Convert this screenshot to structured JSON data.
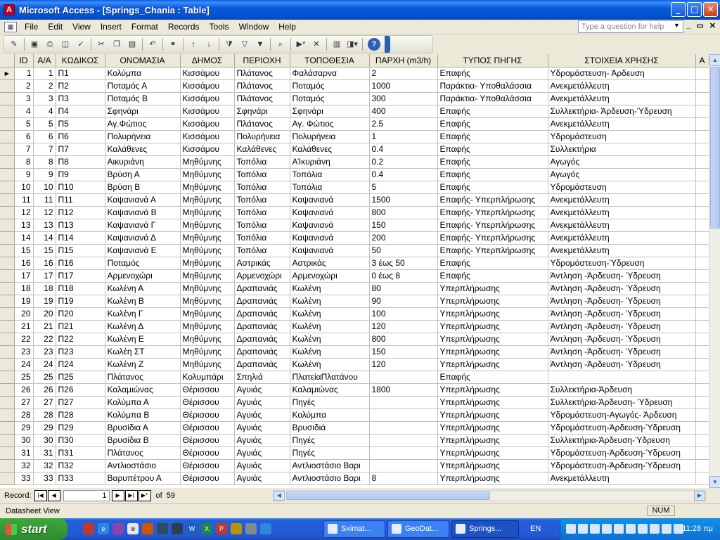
{
  "window": {
    "app_icon": "A",
    "title": "Microsoft Access - [Springs_Chania : Table]",
    "minimize": "_",
    "maximize": "□",
    "close": "✕"
  },
  "menu": {
    "items": [
      "File",
      "Edit",
      "View",
      "Insert",
      "Format",
      "Records",
      "Tools",
      "Window",
      "Help"
    ],
    "help_placeholder": "Type a question for help",
    "mdi": [
      "_",
      "▭",
      "✕"
    ]
  },
  "toolbar": {
    "icons": [
      "design-view-icon",
      "save-icon",
      "print-icon",
      "print-preview-icon",
      "spelling-icon",
      "cut-icon",
      "copy-icon",
      "paste-icon",
      "undo-icon",
      "hyperlink-icon",
      "sort-ascending-icon",
      "sort-descending-icon",
      "filter-by-selection-icon",
      "filter-by-form-icon",
      "apply-filter-icon",
      "find-icon",
      "new-record-icon",
      "delete-record-icon",
      "database-window-icon",
      "new-object-icon",
      "help-icon"
    ]
  },
  "table": {
    "columns": [
      "ID",
      "Α/Α",
      "ΚΩΔΙΚΟΣ",
      "ΟΝΟΜΑΣΙΑ",
      "ΔΗΜΟΣ",
      "ΠΕΡΙΟΧΗ",
      "ΤΟΠΟΘΕΣΙΑ",
      "ΠΑΡΧΗ (m3/h)",
      "ΤΥΠΟΣ ΠΗΓΗΣ",
      "ΣΤΟΙΧΕΙΑ ΧΡΗΣΗΣ",
      "Α"
    ],
    "rows": [
      [
        "1",
        "1",
        "Π1",
        "Κολύμπα",
        "Κισσάμου",
        "Πλάτανος",
        "Φαλάσαρνα",
        "2",
        "Επαφής",
        "Υδρομάστευση- Άρδευση"
      ],
      [
        "2",
        "2",
        "Π2",
        "Ποταμός Α",
        "Κισσάμου",
        "Πλάτανος",
        "Ποταμός",
        "1000",
        "Παράκτια- Υποθαλάσσια",
        "Ανεκμετάλλευτη"
      ],
      [
        "3",
        "3",
        "Π3",
        "Ποταμός Β",
        "Κισσάμου",
        "Πλάτανος",
        "Ποταμός",
        "300",
        "Παράκτια- Υποθαλάσσια",
        "Ανεκμετάλλευτη"
      ],
      [
        "4",
        "4",
        "Π4",
        "Σφηνάρι",
        "Κισσάμου",
        "Σφηνάρι",
        "Σφηνάρι",
        "400",
        "Επαφής",
        "Συλλεκτήρια- Άρδευση-Ύδρευση"
      ],
      [
        "5",
        "5",
        "Π5",
        "Αγ.Φώτιος",
        "Κισσάμου",
        "Πλάτανος",
        "Αγ. Φώτιος",
        "2.5",
        "Επαφής",
        "Ανεκμετάλλευτη"
      ],
      [
        "6",
        "6",
        "Π6",
        "Πολυρήνεια",
        "Κισσάμου",
        "Πολυρήνεια",
        "Πολυρήνεια",
        "1",
        "Επαφής",
        "Υδρομάστευση"
      ],
      [
        "7",
        "7",
        "Π7",
        "Καλάθενες",
        "Κισσάμου",
        "Καλάθενες",
        "Καλάθενες",
        "0.4",
        "Επαφής",
        "Συλλεκτήρια"
      ],
      [
        "8",
        "8",
        "Π8",
        "Αικυριάνη",
        "Μηθύμνης",
        "Τοπόλια",
        "ΑΊκυριάνη",
        "0.2",
        "Επαφής",
        "Αγωγός"
      ],
      [
        "9",
        "9",
        "Π9",
        "Βρύση Α",
        "Μηθύμνης",
        "Τοπόλια",
        "Τοπόλια",
        "0.4",
        "Επαφής",
        "Αγωγός"
      ],
      [
        "10",
        "10",
        "Π10",
        "Βρύση Β",
        "Μηθύμνης",
        "Τοπόλια",
        "Τοπόλια",
        "5",
        "Επαφής",
        "Υδρομάστευση"
      ],
      [
        "11",
        "11",
        "Π11",
        "Καψανιανά Α",
        "Μηθύμνης",
        "Τοπόλια",
        "Καψανιανά",
        "1500",
        "Επαφής- Υπερπλήρωσης",
        "Ανεκμετάλλευτη"
      ],
      [
        "12",
        "12",
        "Π12",
        "Καψανιανά Β",
        "Μηθύμνης",
        "Τοπόλια",
        "Καψανιανά",
        "800",
        "Επαφής- Υπερπλήρωσης",
        "Ανεκμετάλλευτη"
      ],
      [
        "13",
        "13",
        "Π13",
        "Καψανιανά Γ",
        "Μηθύμνης",
        "Τοπόλια",
        "Καψανιανά",
        "150",
        "Επαφής- Υπερπλήρωσης",
        "Ανεκμετάλλευτη"
      ],
      [
        "14",
        "14",
        "Π14",
        "Καψανιανά Δ",
        "Μηθύμνης",
        "Τοπόλια",
        "Καψανιανά",
        "200",
        "Επαφής- Υπερπλήρωσης",
        "Ανεκμετάλλευτη"
      ],
      [
        "15",
        "15",
        "Π15",
        "Καψανιανά Ε",
        "Μηθύμνης",
        "Τοπόλια",
        "Καψανιανά",
        "50",
        "Επαφής- Υπερπλήρωσης",
        "Ανεκμετάλλευτη"
      ],
      [
        "16",
        "16",
        "Π16",
        "Ποταμός",
        "Μηθύμνης",
        "Αστρικάς",
        "Αστρικάς",
        "3 έως 50",
        "Επαφής",
        "Υδρομάστευση-Ύδρευση"
      ],
      [
        "17",
        "17",
        "Π17",
        "Αρμενοχώρι",
        "Μηθύμνης",
        "Αρμενοχώρι",
        "Αρμενοχώρι",
        "0 έως 8",
        "Επαφής",
        "Άντληση -Άρδευση- Ύδρευση"
      ],
      [
        "18",
        "18",
        "Π18",
        "Κωλένη Α",
        "Μηθύμνης",
        "Δραπανιάς",
        "Κωλένη",
        "80",
        "Υπερπλήρωσης",
        "Άντληση -Άρδευση- Ύδρευση"
      ],
      [
        "19",
        "19",
        "Π19",
        "Κωλένη Β",
        "Μηθύμνης",
        "Δραπανιάς",
        "Κωλένη",
        "90",
        "Υπερπλήρωσης",
        "Άντληση -Άρδευση- Ύδρευση"
      ],
      [
        "20",
        "20",
        "Π20",
        "Κωλένη Γ",
        "Μηθύμνης",
        "Δραπανιάς",
        "Κωλένη",
        "100",
        "Υπερπλήρωσης",
        "Άντληση -Άρδευση- Ύδρευση"
      ],
      [
        "21",
        "21",
        "Π21",
        "Κωλένη Δ",
        "Μηθύμνης",
        "Δραπανιάς",
        "Κωλένη",
        "120",
        "Υπερπλήρωσης",
        "Άντληση -Άρδευση- Ύδρευση"
      ],
      [
        "22",
        "22",
        "Π22",
        "Κωλένη Ε",
        "Μηθύμνης",
        "Δραπανιάς",
        "Κωλένη",
        "800",
        "Υπερπλήρωσης",
        "Άντληση -Άρδευση- Ύδρευση"
      ],
      [
        "23",
        "23",
        "Π23",
        "Κωλέη ΣΤ",
        "Μηθύμνης",
        "Δραπανιάς",
        "Κωλένη",
        "150",
        "Υπερπλήρωσης",
        "Άντληση -Άρδευση- Ύδρευση"
      ],
      [
        "24",
        "24",
        "Π24",
        "Κωλένη Ζ",
        "Μηθύμνης",
        "Δραπανιάς",
        "Κωλένη",
        "120",
        "Υπερπλήρωσης",
        "Άντληση -Άρδευση- Ύδρευση"
      ],
      [
        "25",
        "25",
        "Π25",
        "Πλάτανος",
        "Κολυμπάρι",
        "Σπηλιά",
        "ΠλατείαΠλατάνου",
        "",
        "Επαφής",
        ""
      ],
      [
        "26",
        "26",
        "Π26",
        "Καλαμιώνας",
        "Θέρισσου",
        "Αγυιάς",
        "Καλαμιώνας",
        "1800",
        "Υπερπλήρωσης",
        "Συλλεκτήρια-Άρδευση"
      ],
      [
        "27",
        "27",
        "Π27",
        "Κολύμπα Α",
        "Θέρισσου",
        "Αγυιάς",
        "Πηγές",
        "",
        "Υπερπλήρωσης",
        "Συλλεκτήρια-Άρδευση- Ύδρευση"
      ],
      [
        "28",
        "28",
        "Π28",
        "Κολύμπα Β",
        "Θέρισσου",
        "Αγυιάς",
        "Κολύμπα",
        "",
        "Υπερπλήρωσης",
        "Υδρομάστευση-Αγωγός- Άρδευση"
      ],
      [
        "29",
        "29",
        "Π29",
        "Βρυσίδια Α",
        "Θέρισσου",
        "Αγυιάς",
        "Βρυσιδιά",
        "",
        "Υπερπλήρωσης",
        "Υδρομάστευση-Άρδευση-Ύδρευση"
      ],
      [
        "30",
        "30",
        "Π30",
        "Βρυσίδια Β",
        "Θέρισσου",
        "Αγυιάς",
        "Πηγές",
        "",
        "Υπερπλήρωσης",
        "Συλλεκτήρια-Άρδευση-Ύδρευση"
      ],
      [
        "31",
        "31",
        "Π31",
        "Πλάτανος",
        "Θέρισσου",
        "Αγυιάς",
        "Πηγές",
        "",
        "Υπερπλήρωσης",
        "Υδρομάστευση-Άρδευση-Ύδρευση"
      ],
      [
        "32",
        "32",
        "Π32",
        "Αντλιοστάσιο",
        "Θέρισσου",
        "Αγυιάς",
        "Αντλιοστάσιο Βαρι",
        "",
        "Υπερπλήρωσης",
        "Υδρομάστευση-Άρδευση-Ύδρευση"
      ],
      [
        "33",
        "33",
        "Π33",
        "Βαρυπέτρου Α",
        "Θέρισσου",
        "Αγυιάς",
        "Αντλιοστάσιο Βαρι",
        "8",
        "Υπερπλήρωσης",
        "Ανεκμετάλλευτη"
      ]
    ]
  },
  "record_nav": {
    "label": "Record:",
    "current": "1",
    "of_label": "of",
    "total": "59",
    "first": "|◀",
    "prev": "◀",
    "next": "▶",
    "last": "▶|",
    "new": "▶*"
  },
  "status": {
    "text": "Datasheet View",
    "num": "NUM"
  },
  "taskbar": {
    "start": "start",
    "tasks": [
      "Sximat...",
      "GeoDat...",
      "Springs..."
    ],
    "lang": "EN",
    "clock": "11:28 πμ"
  }
}
